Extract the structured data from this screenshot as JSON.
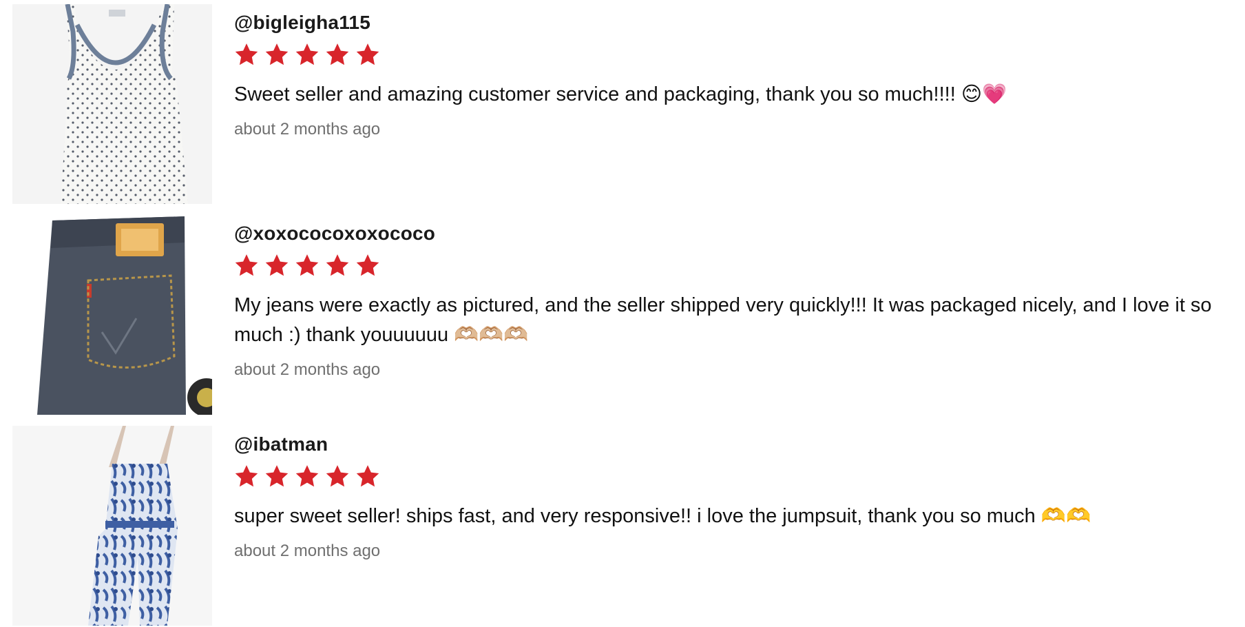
{
  "reviews": [
    {
      "username": "@bigleigha115",
      "rating": 5,
      "comment": "Sweet seller and amazing customer service and packaging, thank you so much!!!! 😊💗",
      "time": "about 2 months ago",
      "image": "white-polka-dot-tank-top"
    },
    {
      "username": "@xoxococoxoxococo",
      "rating": 5,
      "comment": "My jeans were exactly as pictured, and the seller shipped very quickly!!! It was packaged nicely, and I love it so much :) thank youuuuuu 🫶🏼🫶🏼🫶🏼",
      "time": "about 2 months ago",
      "image": "denim-jeans-back-pocket"
    },
    {
      "username": "@ibatman",
      "rating": 5,
      "comment": "super sweet seller! ships fast, and very responsive!! i love the jumpsuit, thank you so much 🫶🫶",
      "time": "about 2 months ago",
      "image": "blue-floral-jumpsuit"
    }
  ],
  "colors": {
    "star": "#d8252b",
    "time": "#6f6f6f",
    "username": "#1a1a1a"
  }
}
